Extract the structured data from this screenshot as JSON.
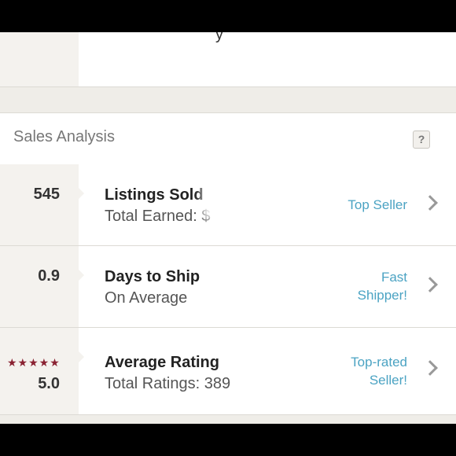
{
  "header": {
    "cut_text": "y"
  },
  "section": {
    "title": "Sales Analysis",
    "help_label": "?"
  },
  "rows": [
    {
      "metric": "545",
      "title": "Listings Sold",
      "subtitle": "Total Earned: $",
      "badge_line1": "Top Seller",
      "badge_line2": ""
    },
    {
      "metric": "0.9",
      "title": "Days to Ship",
      "subtitle": "On Average",
      "badge_line1": "Fast",
      "badge_line2": "Shipper!"
    },
    {
      "metric": "5.0",
      "stars": "★★★★★",
      "rating_value": 5,
      "title": "Average Rating",
      "subtitle": "Total Ratings: 389",
      "badge_line1": "Top-rated",
      "badge_line2": "Seller!"
    }
  ],
  "colors": {
    "accent_link": "#4ba3c3",
    "star": "#8a2232"
  }
}
